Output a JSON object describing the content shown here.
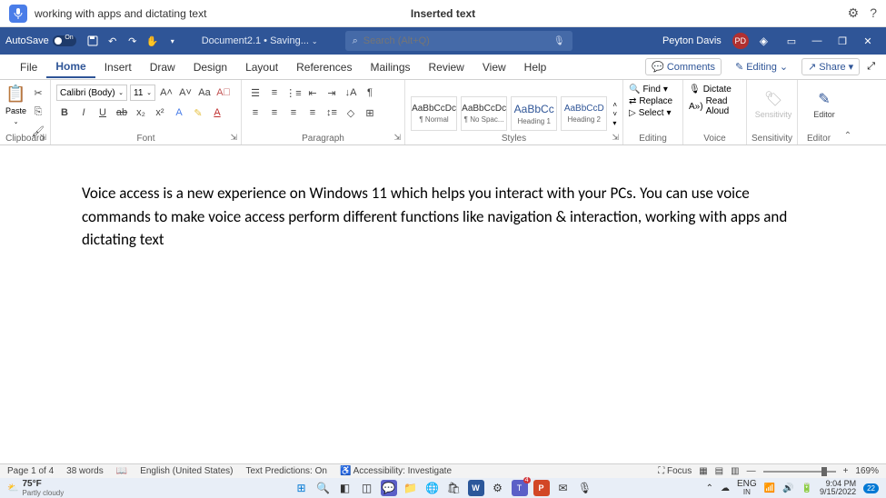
{
  "voice_bar": {
    "dictation_text": "working with apps and dictating text",
    "status": "Inserted text"
  },
  "title_bar": {
    "autosave_label": "AutoSave",
    "autosave_on": "On",
    "doc_name": "Document2.1 • Saving...",
    "search_placeholder": "Search (Alt+Q)",
    "user_name": "Peyton Davis",
    "user_initials": "PD"
  },
  "tabs": [
    "File",
    "Home",
    "Insert",
    "Draw",
    "Design",
    "Layout",
    "References",
    "Mailings",
    "Review",
    "View",
    "Help"
  ],
  "tabs_right": {
    "comments": "Comments",
    "editing": "Editing",
    "share": "Share"
  },
  "ribbon": {
    "clipboard": {
      "paste": "Paste",
      "label": "Clipboard"
    },
    "font": {
      "name": "Calibri (Body)",
      "size": "11",
      "label": "Font"
    },
    "paragraph": {
      "label": "Paragraph"
    },
    "styles": {
      "label": "Styles",
      "items": [
        {
          "preview": "AaBbCcDc",
          "name": "¶ Normal"
        },
        {
          "preview": "AaBbCcDc",
          "name": "¶ No Spac..."
        },
        {
          "preview": "AaBbCc",
          "name": "Heading 1"
        },
        {
          "preview": "AaBbCcD",
          "name": "Heading 2"
        }
      ]
    },
    "editing": {
      "find": "Find",
      "replace": "Replace",
      "select": "Select",
      "label": "Editing"
    },
    "voice": {
      "dictate": "Dictate",
      "read": "Read Aloud",
      "label": "Voice"
    },
    "sensitivity": {
      "btn": "Sensitivity",
      "label": "Sensitivity"
    },
    "editor": {
      "btn": "Editor",
      "label": "Editor"
    }
  },
  "document": {
    "body": "Voice access is a new experience on Windows 11 which helps you interact with your PCs. You can use voice commands to make voice access perform different functions like navigation & interaction, working with apps and dictating text"
  },
  "status": {
    "page": "Page 1 of 4",
    "words": "38 words",
    "lang": "English (United States)",
    "predictions": "Text Predictions: On",
    "accessibility": "Accessibility: Investigate",
    "focus": "Focus",
    "zoom": "169%"
  },
  "taskbar": {
    "temp": "75°F",
    "weather": "Partly cloudy",
    "lang1": "ENG",
    "lang2": "IN",
    "time": "9:04 PM",
    "date": "9/15/2022",
    "notif": "22"
  }
}
